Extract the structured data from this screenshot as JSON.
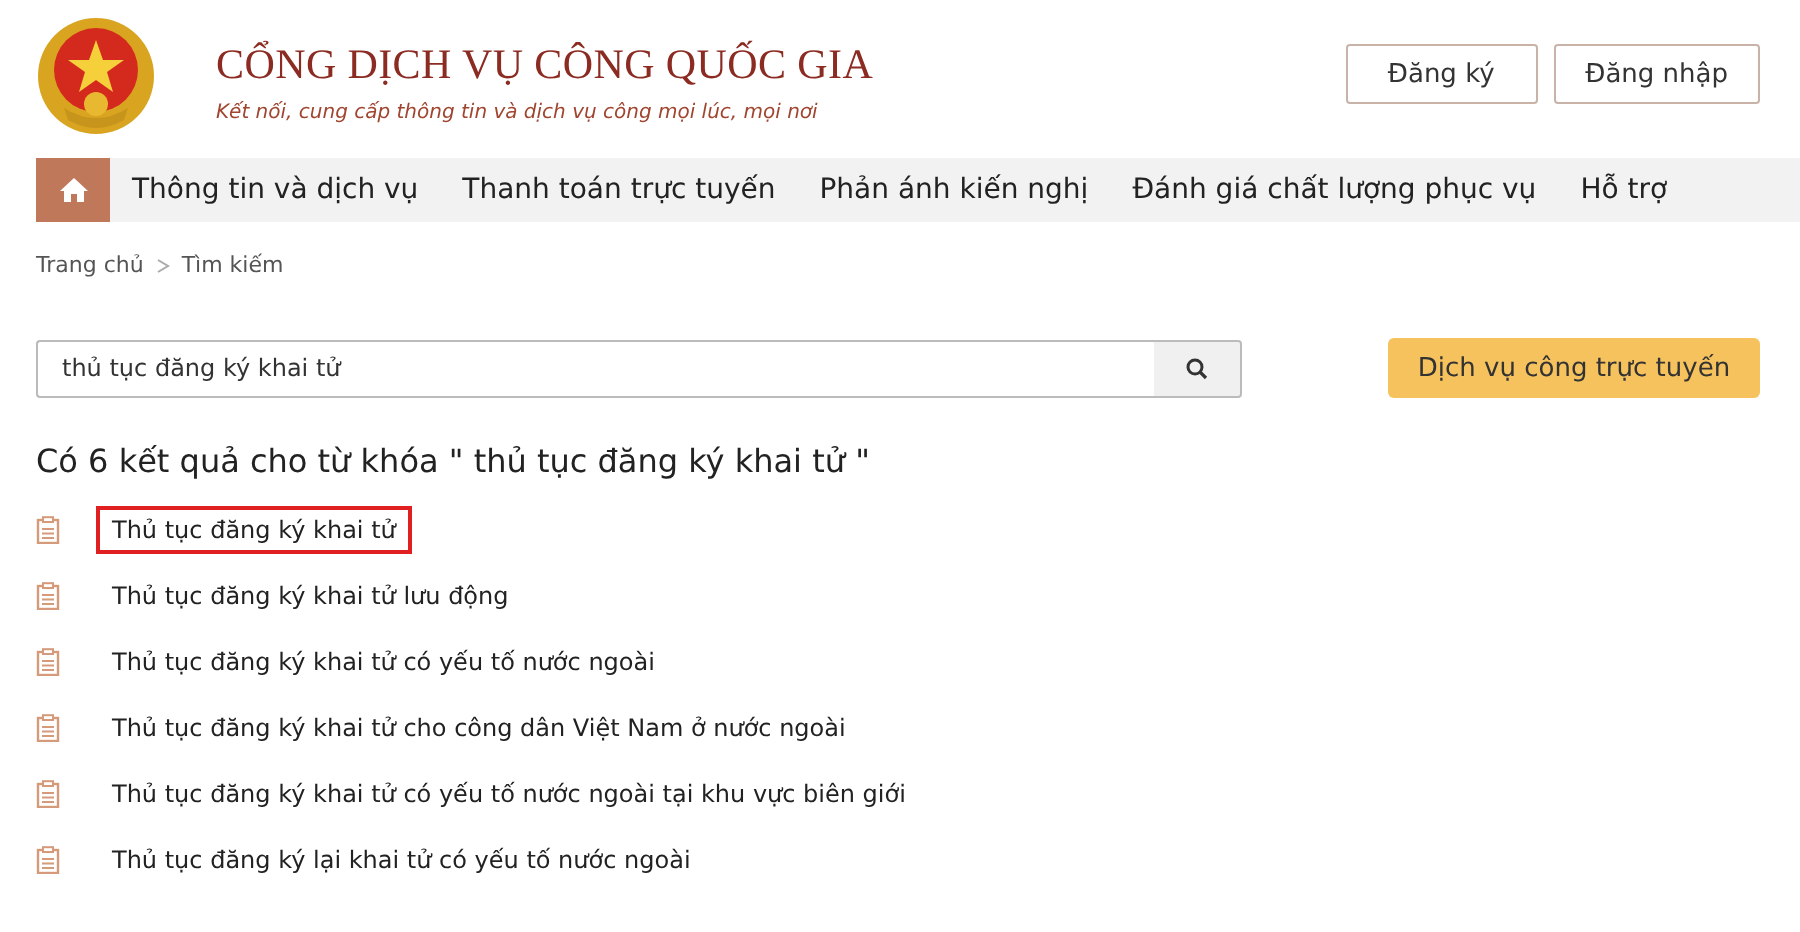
{
  "header": {
    "title": "CỔNG DỊCH VỤ CÔNG QUỐC GIA",
    "subtitle": "Kết nối, cung cấp thông tin và dịch vụ công mọi lúc, mọi nơi",
    "buttons": [
      "Đăng ký",
      "Đăng nhập"
    ]
  },
  "nav": {
    "items": [
      "Thông tin và dịch vụ",
      "Thanh toán trực tuyến",
      "Phản ánh kiến nghị",
      "Đánh giá chất lượng phục vụ",
      "Hỗ trợ"
    ]
  },
  "breadcrumb": [
    "Trang chủ",
    "Tìm kiếm"
  ],
  "search": {
    "value": "thủ tục đăng ký khai tử"
  },
  "online_button": "Dịch vụ công trực tuyến",
  "results_heading": "Có 6 kết quả cho từ khóa \" thủ tục đăng ký khai tử \"",
  "results": [
    {
      "title": "Thủ tục đăng ký khai tử",
      "highlighted": true
    },
    {
      "title": "Thủ tục đăng ký khai tử lưu động",
      "highlighted": false
    },
    {
      "title": "Thủ tục đăng ký khai tử có yếu tố nước ngoài",
      "highlighted": false
    },
    {
      "title": "Thủ tục đăng ký khai tử cho công dân Việt Nam ở nước ngoài",
      "highlighted": false
    },
    {
      "title": "Thủ tục đăng ký khai tử có yếu tố nước ngoài tại khu vực biên giới",
      "highlighted": false
    },
    {
      "title": "Thủ tục đăng ký lại khai tử có yếu tố nước ngoài",
      "highlighted": false
    }
  ]
}
